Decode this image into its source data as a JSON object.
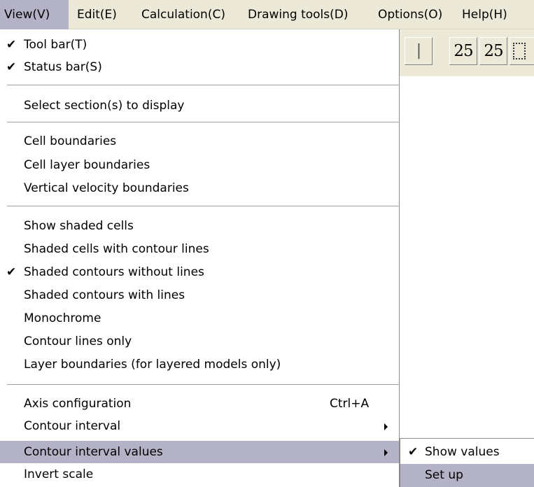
{
  "menubar": {
    "view": "View(V)",
    "edit": "Edit(E)",
    "calculation": "Calculation(C)",
    "drawing_tools": "Drawing tools(D)",
    "options": "Options(O)",
    "help": "Help(H)"
  },
  "toolbar": {
    "btn_bar": "|",
    "btn_25a": "25",
    "btn_25b": "25"
  },
  "view_menu": {
    "items": [
      {
        "label": "Tool bar(T)",
        "checked": true
      },
      {
        "label": "Status bar(S)",
        "checked": true
      },
      {
        "label": "Select section(s) to display"
      },
      {
        "label": "Cell boundaries"
      },
      {
        "label": "Cell layer boundaries"
      },
      {
        "label": "Vertical velocity boundaries"
      },
      {
        "label": "Show shaded cells"
      },
      {
        "label": "Shaded cells with contour lines"
      },
      {
        "label": "Shaded contours without lines",
        "checked": true
      },
      {
        "label": "Shaded contours with lines"
      },
      {
        "label": "Monochrome"
      },
      {
        "label": "Contour lines only"
      },
      {
        "label": "Layer boundaries (for layered models only)"
      },
      {
        "label": "Axis configuration",
        "shortcut": "Ctrl+A"
      },
      {
        "label": "Contour interval",
        "submenu": true
      },
      {
        "label": "Contour interval values",
        "submenu": true,
        "highlighted": true
      },
      {
        "label": "Invert scale"
      }
    ],
    "check_glyph": "✔"
  },
  "submenu": {
    "items": [
      {
        "label": "Show values",
        "checked": true
      },
      {
        "label": "Set up",
        "highlighted": true
      }
    ]
  },
  "colors": {
    "menubar_bg": "#ece9d8",
    "highlight": "#b4b2c6",
    "separator": "#a0a0a0"
  }
}
